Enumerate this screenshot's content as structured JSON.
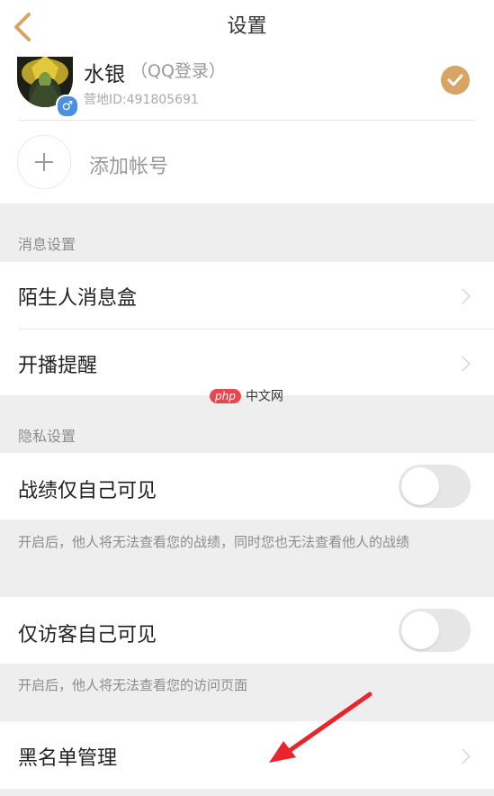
{
  "header": {
    "title": "设置"
  },
  "account": {
    "name": "水银",
    "login_type": "（QQ登录）",
    "id_text": "营地ID:491805691",
    "gender_symbol": "♂",
    "add_account_label": "添加帐号"
  },
  "sections": {
    "message": {
      "title": "消息设置",
      "items": [
        {
          "label": "陌生人消息盒"
        },
        {
          "label": "开播提醒"
        }
      ]
    },
    "privacy": {
      "title": "隐私设置",
      "record_only_self": {
        "label": "战绩仅自己可见",
        "on": false
      },
      "record_note": "开启后，他人将无法查看您的战绩，同时您也无法查看他人的战绩",
      "visitor_only_self": {
        "label": "仅访客自己可见",
        "on": false
      },
      "visitor_note": "开启后，他人将无法查看您的访问页面",
      "blacklist": {
        "label": "黑名单管理"
      }
    }
  },
  "watermark": {
    "php": "php",
    "cn": "中文网"
  },
  "colors": {
    "accent": "#d8a464",
    "annotation_arrow": "#e8252a",
    "gender_badge": "#4a90e2"
  }
}
